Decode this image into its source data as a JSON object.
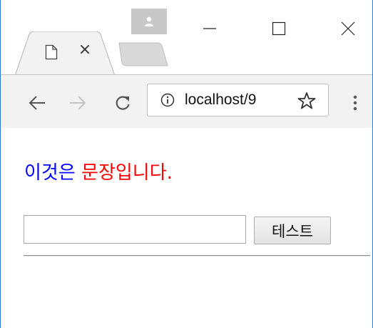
{
  "browser": {
    "tab": {
      "title": "",
      "close_glyph": "×",
      "icon": "page-icon"
    },
    "toolbar": {
      "url": "localhost/9",
      "icons": [
        "back-arrow-icon",
        "forward-arrow-icon",
        "reload-icon",
        "info-icon",
        "star-icon",
        "menu-icon"
      ]
    },
    "window_controls": [
      "minimize-icon",
      "maximize-icon",
      "close-icon"
    ],
    "profile_icon": "profile-icon"
  },
  "page": {
    "sentence_part1": "이것은",
    "sentence_part2": "문장입니다.",
    "input": {
      "value": "",
      "placeholder": ""
    },
    "button_label": "테스트"
  },
  "colors": {
    "part1": "#0000ff",
    "part2": "#ff0000",
    "toolbar_bg": "#f2f2f2",
    "window_border": "#2b79d0"
  }
}
